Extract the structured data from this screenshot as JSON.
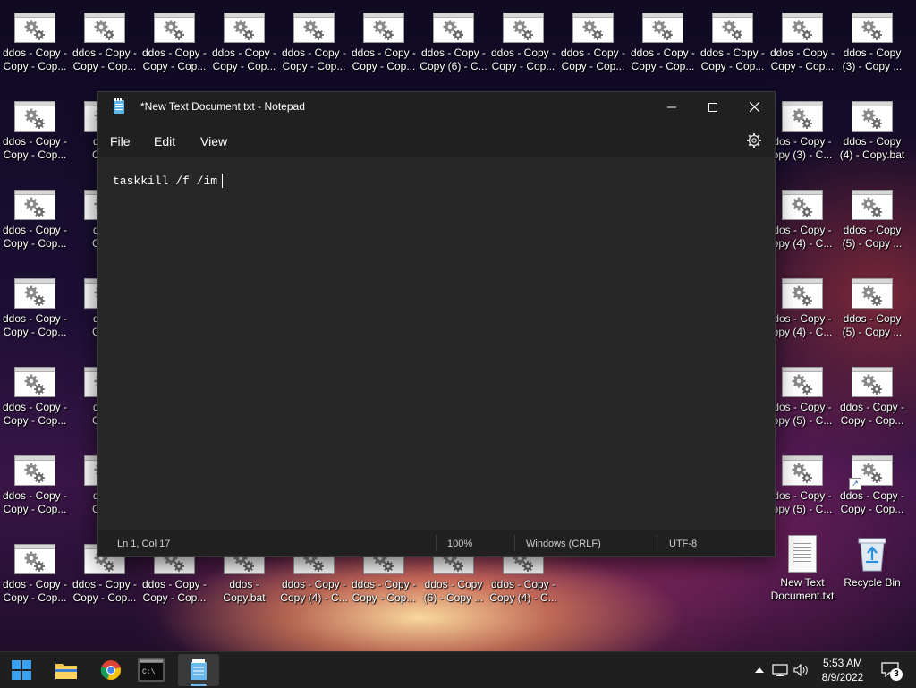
{
  "desktop": {
    "row0": [
      "ddos - Copy -\nCopy - Cop...",
      "ddos - Copy -\nCopy - Cop...",
      "ddos - Copy -\nCopy - Cop...",
      "ddos - Copy -\nCopy - Cop...",
      "ddos - Copy -\nCopy - Cop...",
      "ddos - Copy -\nCopy - Cop...",
      "ddos - Copy -\nCopy (6) - C...",
      "ddos - Copy -\nCopy - Cop...",
      "ddos - Copy -\nCopy - Cop...",
      "ddos - Copy -\nCopy - Cop...",
      "ddos - Copy -\nCopy - Cop...",
      "ddos - Copy -\nCopy - Cop...",
      "ddos - Copy\n(3) - Copy ..."
    ],
    "left_col": [
      "ddos - Copy -\nCopy - Cop...",
      "ddos - Copy -\nCopy - Cop...",
      "ddos - Copy -\nCopy - Cop...",
      "ddos - Copy -\nCopy - Cop...",
      "ddos - Copy -\nCopy - Cop..."
    ],
    "second_col": [
      "ddos\nCopy",
      "ddos\nCopy",
      "ddos\nCopy",
      "ddos\nCopy",
      "ddos\nCopy"
    ],
    "right_col_a": [
      "dos - Copy -\nopy (3) - C...",
      "dos - Copy -\nopy (4) - C...",
      "dos - Copy -\nopy (4) - C...",
      "dos - Copy -\nopy (5) - C...",
      "dos - Copy -\nopy (5) - C..."
    ],
    "right_col_b": [
      "ddos - Copy\n(4) - Copy.bat",
      "ddos - Copy\n(5) - Copy ...",
      "ddos - Copy\n(5) - Copy ...",
      "ddos - Copy -\nCopy - Cop...",
      "ddos - Copy -\nCopy - Cop..."
    ],
    "bottom_row": [
      "ddos - Copy -\nCopy - Cop...",
      "ddos - Copy -\nCopy - Cop...",
      "ddos - Copy -\nCopy - Cop...",
      "ddos -\nCopy.bat",
      "ddos - Copy -\nCopy (4) - C...",
      "ddos - Copy -\nCopy - Cop...",
      "ddos - Copy\n(6) - Copy ...",
      "ddos - Copy -\nCopy (4) - C..."
    ],
    "new_text_document": "New Text\nDocument.txt",
    "recycle_bin": "Recycle Bin"
  },
  "notepad": {
    "title": "*New Text Document.txt - Notepad",
    "menus": {
      "file": "File",
      "edit": "Edit",
      "view": "View"
    },
    "content": "taskkill /f /im",
    "status": {
      "position": "Ln 1, Col 17",
      "zoom": "100%",
      "line_ending": "Windows (CRLF)",
      "encoding": "UTF-8"
    }
  },
  "taskbar": {
    "time": "5:53 AM",
    "date": "8/9/2022",
    "notification_count": "3"
  },
  "icons": {
    "start": "windows-start-icon",
    "explorer": "folder-icon",
    "chrome": "chrome-icon",
    "cmd": "terminal-icon",
    "notepad": "notepad-icon"
  }
}
